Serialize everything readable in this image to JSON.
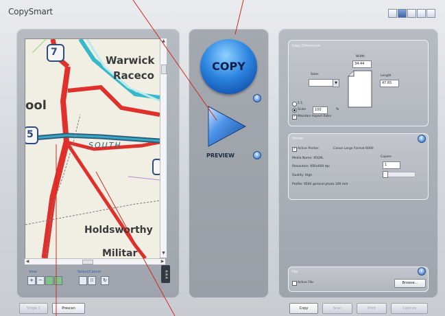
{
  "app": {
    "title": "CopySmart"
  },
  "map": {
    "route_numbers": [
      "7",
      "5"
    ],
    "labels": {
      "warwick": "Warwick",
      "raceco": "Raceco",
      "ool": "ool",
      "south": "SOUTH",
      "holdsworthy": "Holdsworthy",
      "military": "Militar"
    }
  },
  "left_panel": {
    "view_label": "View",
    "select_label": "Select/Cancel",
    "zoom_value": "4:4:4"
  },
  "center_panel": {
    "copy_label": "COPY",
    "preview_label": "PREVIEW"
  },
  "copy_dimensions": {
    "title": "Copy Dimension",
    "width_label": "Width",
    "width_value": "34.44",
    "length_label": "Length",
    "length_value": "47.65",
    "size_label": "Sizes",
    "size_value": "",
    "option_1_1": "1:1",
    "scale_label": "Scale",
    "scale_value": "100",
    "percent_sign": "%",
    "maintain_aspect": "Maintain Aspect Ratio"
  },
  "printer": {
    "title": "Printer",
    "active_printer_label": "Active Printer:",
    "active_printer_value": "Canon Large Format 6000",
    "media_label": "Media Name: 95Q9L",
    "resolution_label": "Resolution: 600x600 dpi",
    "quality_label": "Quality: High",
    "profile_label": "Profile: 9500 general photo 100 mm",
    "copies_label": "Copies:",
    "copies_value": "1"
  },
  "file": {
    "title": "File",
    "active_file_label": "Active File",
    "browse_label": "Browse..."
  },
  "bottom_left_buttons": [
    "Single C",
    "Prescan"
  ],
  "bottom_right_buttons": [
    "Copy",
    "Scan",
    "Print",
    "Capture"
  ]
}
